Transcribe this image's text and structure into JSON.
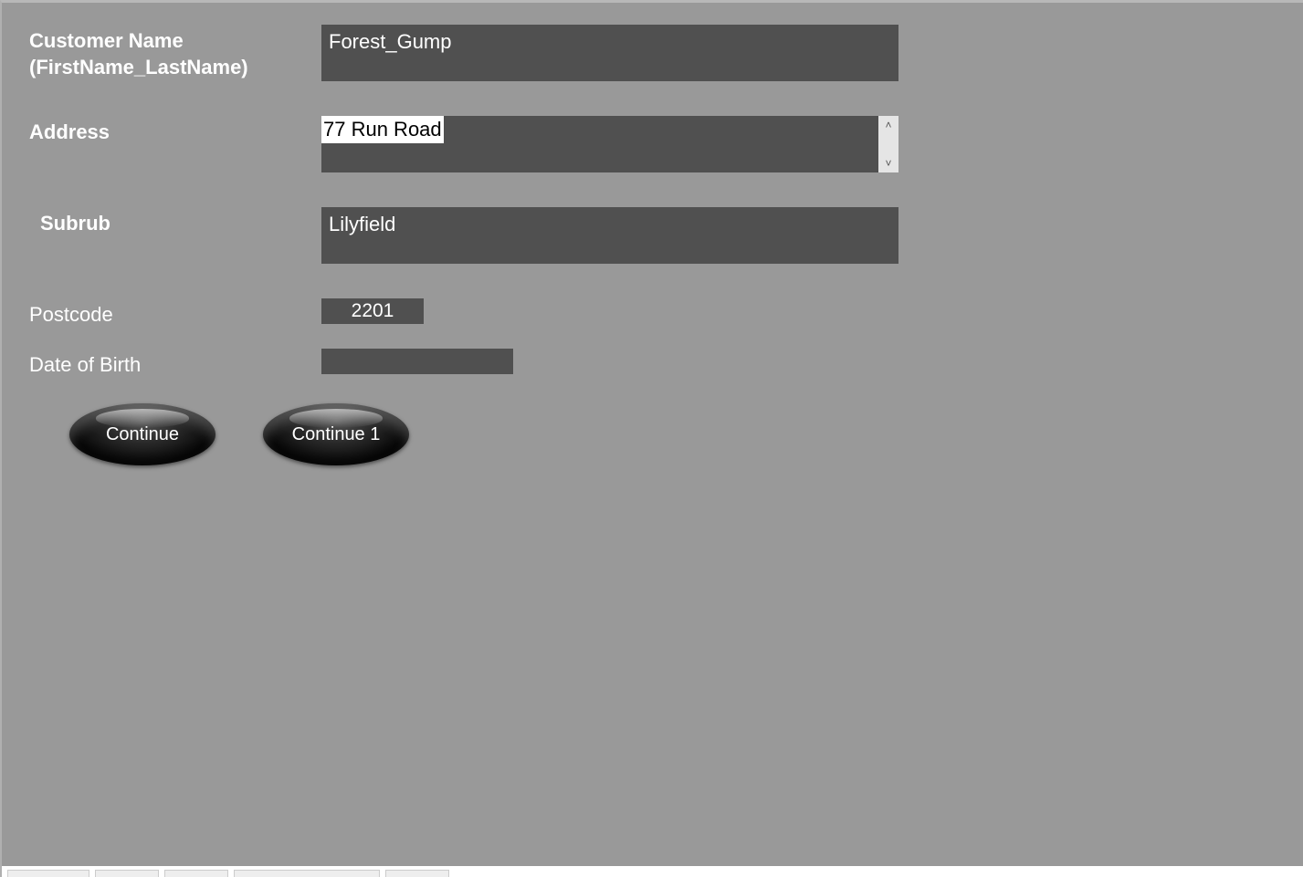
{
  "form": {
    "customer_name": {
      "label_line1": "Customer Name",
      "label_line2": "(FirstName_LastName)",
      "value": "Forest_Gump"
    },
    "address": {
      "label": "Address",
      "value": "77 Run Road"
    },
    "suburb": {
      "label": "Subrub",
      "value": "Lilyfield"
    },
    "postcode": {
      "label": "Postcode",
      "value": "2201"
    },
    "dob": {
      "label": "Date of Birth",
      "value": ""
    }
  },
  "buttons": {
    "continue": "Continue",
    "continue1": "Continue 1"
  },
  "icons": {
    "up": "˄",
    "down": "˅"
  }
}
